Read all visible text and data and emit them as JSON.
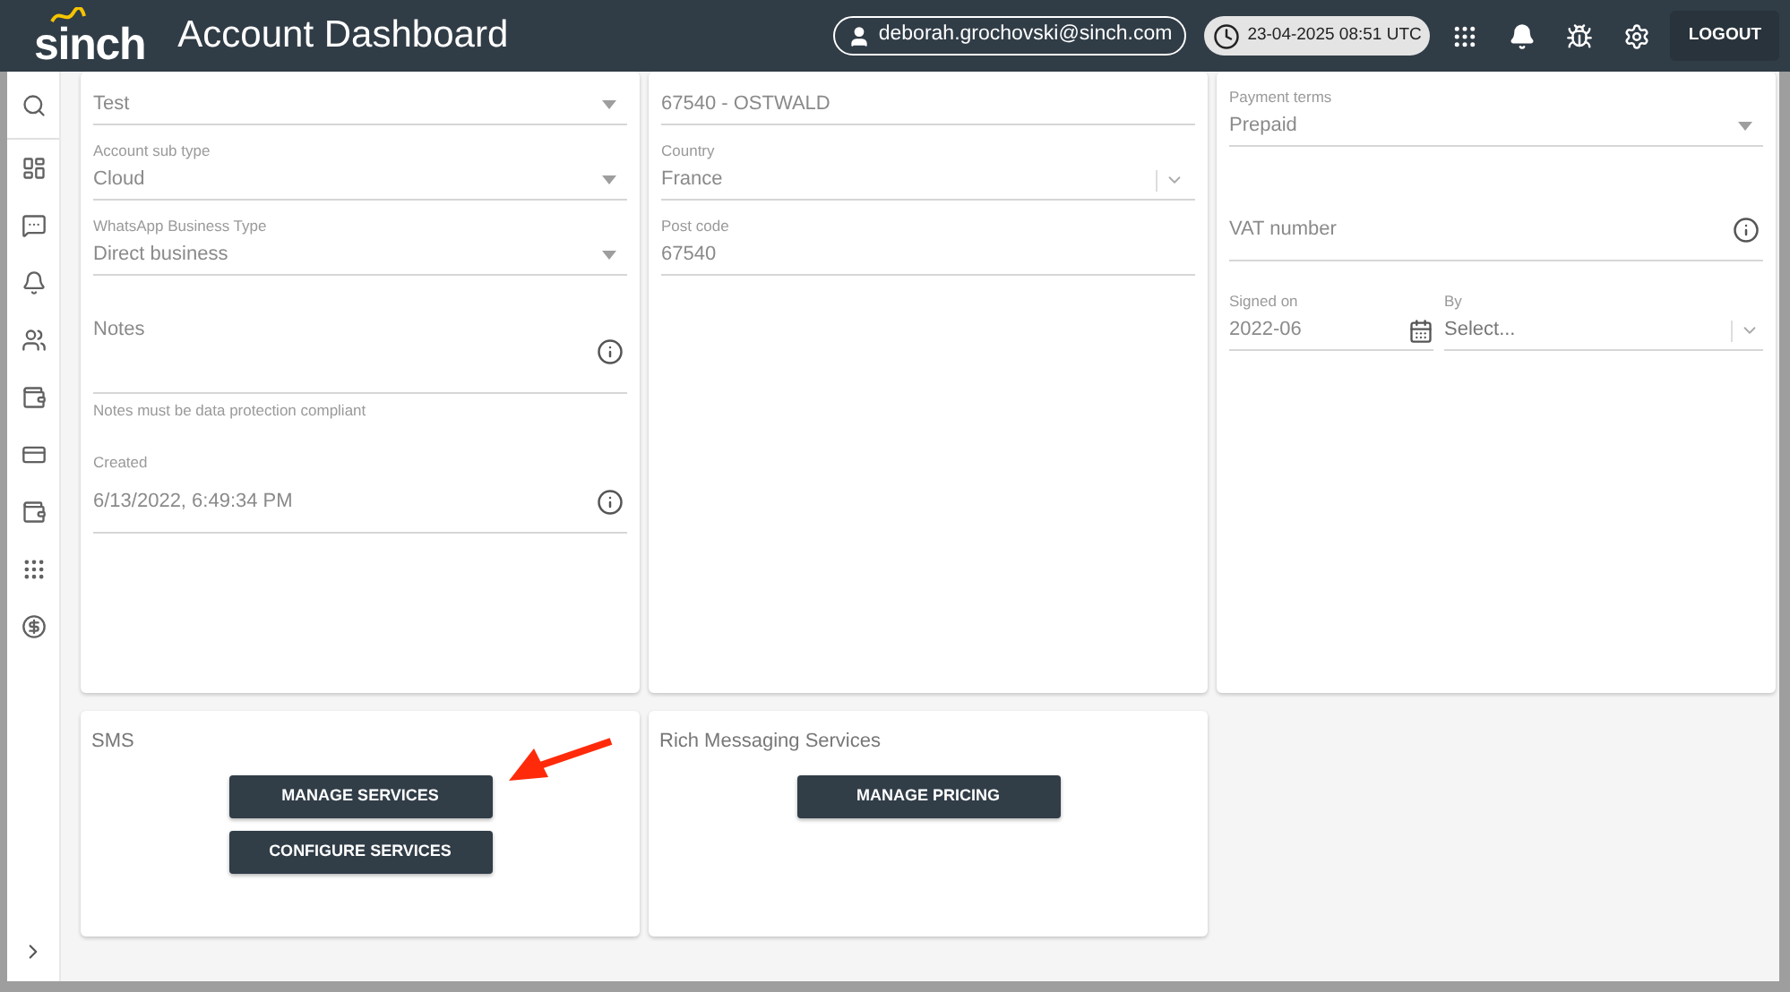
{
  "header": {
    "logo": "sinch",
    "title": "Account Dashboard",
    "user": "deborah.grochovski@sinch.com",
    "datetime": "23-04-2025 08:51 UTC",
    "logout": "LOGOUT"
  },
  "columns": [
    {
      "fields": [
        {
          "kind": "select",
          "value": "Test"
        },
        {
          "kind": "select",
          "label": "Account sub type",
          "value": "Cloud"
        },
        {
          "kind": "select",
          "label": "WhatsApp Business Type",
          "value": "Direct business"
        },
        {
          "kind": "notes",
          "placeholder": "Notes",
          "hint": "Notes must be data protection compliant"
        },
        {
          "kind": "info",
          "label": "Created",
          "value": "6/13/2022, 6:49:34 PM"
        }
      ]
    },
    {
      "fields": [
        {
          "kind": "text",
          "value": "67540 - OSTWALD"
        },
        {
          "kind": "combo",
          "label": "Country",
          "value": "France"
        },
        {
          "kind": "text",
          "label": "Post code",
          "value": "67540"
        }
      ]
    },
    {
      "fields": [
        {
          "kind": "select",
          "label": "Payment terms",
          "value": "Prepaid"
        },
        {
          "kind": "info",
          "placeholder": "VAT number"
        },
        {
          "kind": "signed",
          "label": "Signed on",
          "value": "2022-06",
          "by_label": "By",
          "by_placeholder": "Select..."
        }
      ]
    }
  ],
  "sections": [
    {
      "title": "SMS",
      "buttons": [
        "MANAGE SERVICES",
        "CONFIGURE SERVICES"
      ]
    },
    {
      "title": "Rich Messaging Services",
      "buttons": [
        "MANAGE PRICING"
      ]
    }
  ]
}
